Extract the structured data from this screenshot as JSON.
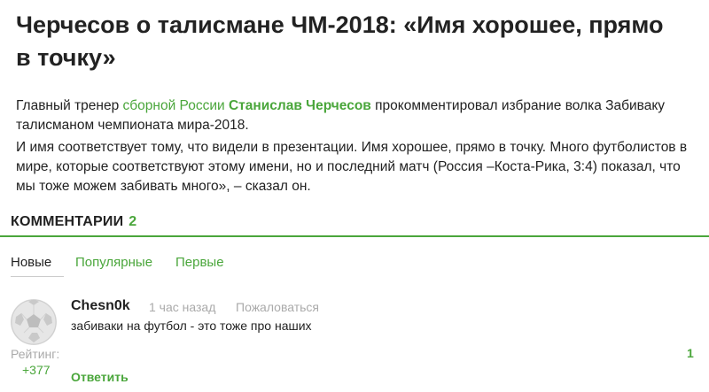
{
  "article": {
    "title": "Черчесов о талисмане ЧМ-2018: «Имя хорошее, прямо в точку»",
    "p1_before": "Главный тренер ",
    "p1_link1": "сборной России",
    "p1_space": " ",
    "p1_link2": "Станислав Черчесов",
    "p1_after": " прокомментировал избрание волка Забиваку талисманом чемпионата мира-2018.",
    "p2": "И имя соответствует тому, что видели в презентации. Имя хорошее, прямо в точку. Много футболистов в мире, которые соответствуют этому имени, но и последний матч (Россия –Коста-Рика, 3:4) показал, что мы тоже можем забивать много», – сказал он."
  },
  "comments": {
    "heading": "КОММЕНТАРИИ",
    "count": "2",
    "tabs": [
      "Новые",
      "Популярные",
      "Первые"
    ],
    "items": [
      {
        "author": "Chesn0k",
        "time": "1 час назад",
        "report": "Пожаловаться",
        "text": "забиваки на футбол - это тоже про наших",
        "rating_label": "Рейтинг:",
        "rating": "+377",
        "reply": "Ответить",
        "score": "1",
        "avatar_icon": "soccer-ball-icon"
      }
    ]
  },
  "colors": {
    "accent": "#4aa63b",
    "muted": "#aaaaaa",
    "text": "#222222"
  }
}
